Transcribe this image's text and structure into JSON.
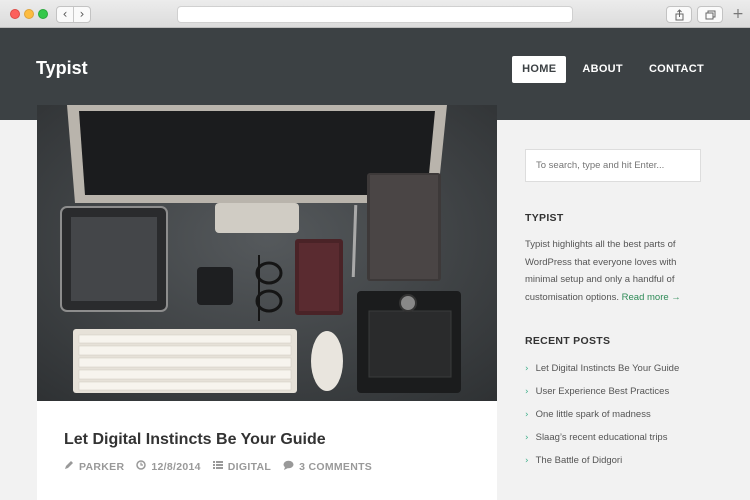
{
  "browser": {
    "back_icon": "‹",
    "forward_icon": "›",
    "new_tab_icon": "+"
  },
  "site": {
    "title": "Typist",
    "nav": [
      {
        "label": "HOME",
        "active": true
      },
      {
        "label": "ABOUT",
        "active": false
      },
      {
        "label": "CONTACT",
        "active": false
      }
    ]
  },
  "post": {
    "title": "Let Digital Instincts Be Your Guide",
    "author": "PARKER",
    "date": "12/8/2014",
    "category": "DIGITAL",
    "comments": "3 COMMENTS"
  },
  "sidebar": {
    "search_placeholder": "To search, type and hit Enter...",
    "about_title": "TYPIST",
    "about_text": "Typist highlights all the best parts of WordPress that everyone loves with minimal setup and only a handful of customisation options.",
    "read_more": "Read more →",
    "recent_title": "RECENT POSTS",
    "recent_posts": [
      "Let Digital Instincts Be Your Guide",
      "User Experience Best Practices",
      "One little spark of madness",
      "Slaag’s recent educational trips",
      "The Battle of Didgori"
    ]
  },
  "colors": {
    "header_bg": "#3c4144",
    "accent": "#3fb08b",
    "link": "#2e8b57"
  }
}
